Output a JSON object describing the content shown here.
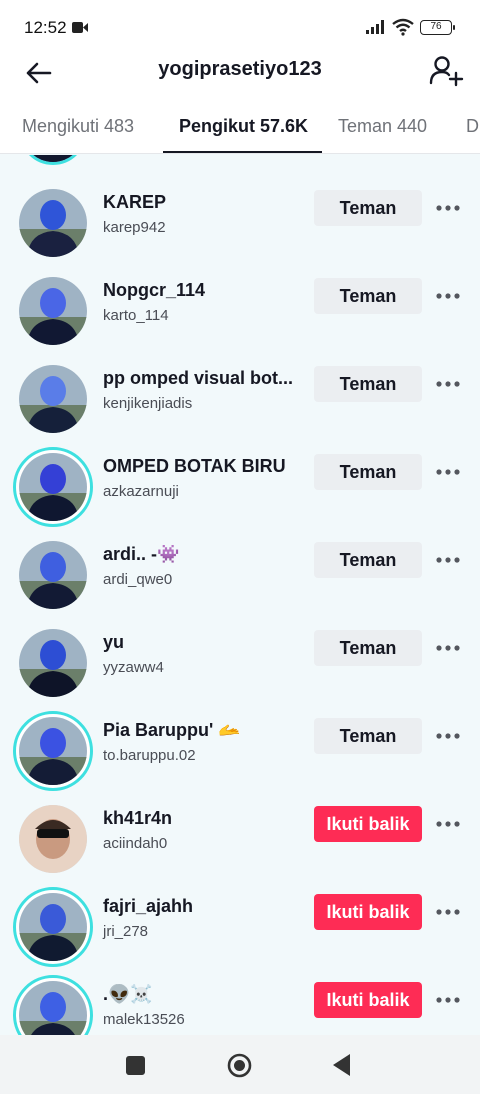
{
  "status_bar": {
    "time": "12:52",
    "battery": "76"
  },
  "header": {
    "title": "yogiprasetiyo123"
  },
  "tabs": [
    {
      "label": "Mengikuti 483"
    },
    {
      "label": "Pengikut 57.6K"
    },
    {
      "label": "Teman 440"
    },
    {
      "label": "Di"
    }
  ],
  "followers": [
    {
      "name": "KAREP",
      "username": "karep942",
      "button": "Teman"
    },
    {
      "name": "Nopgcr_114",
      "username": "karto_114",
      "button": "Teman"
    },
    {
      "name": "pp omped visual bot...",
      "username": "kenjikenjiadis",
      "button": "Teman"
    },
    {
      "name": "OMPED BOTAK BIRU",
      "username": "azkazarnuji",
      "button": "Teman"
    },
    {
      "name": "ardi.. -👾",
      "username": "ardi_qwe0",
      "button": "Teman"
    },
    {
      "name": "yu",
      "username": "yyzaww4",
      "button": "Teman"
    },
    {
      "name": "Pia Baruppu' 🫴",
      "username": "to.baruppu.02",
      "button": "Teman"
    },
    {
      "name": "kh41r4n",
      "username": "aciindah0",
      "button": "Ikuti balik"
    },
    {
      "name": "fajri_ajahh",
      "username": "jri_278",
      "button": "Ikuti balik"
    },
    {
      "name": ".👽☠️",
      "username": "malek13526",
      "button": "Ikuti balik"
    }
  ],
  "colors": {
    "follow_back": "#fe2c55",
    "friend_button": "#ebeef1",
    "story_ring": "#3ee0e0",
    "accent_text": "#161823"
  },
  "icons": [
    "back-arrow-icon",
    "add-user-icon",
    "more-icon",
    "camera-icon",
    "signal-icon",
    "wifi-icon",
    "battery-icon"
  ]
}
